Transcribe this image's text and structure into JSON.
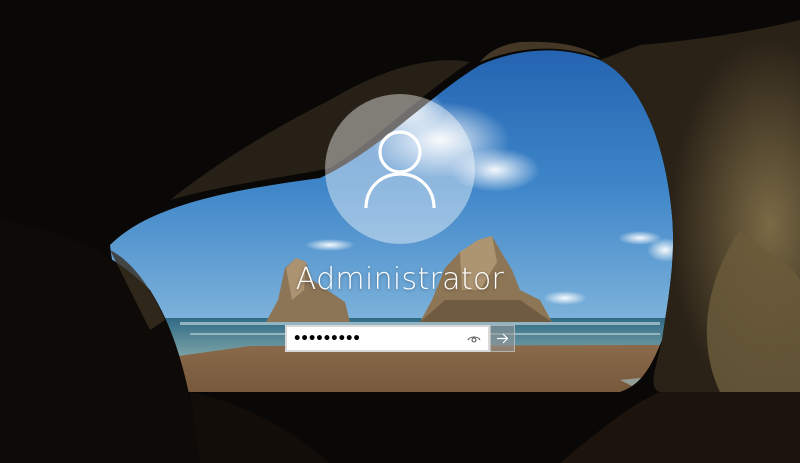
{
  "lockscreen": {
    "username": "Administrator"
  },
  "password_field": {
    "value": "•••••••••"
  },
  "icons": {
    "avatar": "user-silhouette-icon",
    "reveal": "eye-icon",
    "submit": "arrow-right-icon"
  },
  "colors": {
    "avatar_circle": "#ffffff",
    "username_text": "#ffffff",
    "submit_button": "#9a9a9a"
  }
}
